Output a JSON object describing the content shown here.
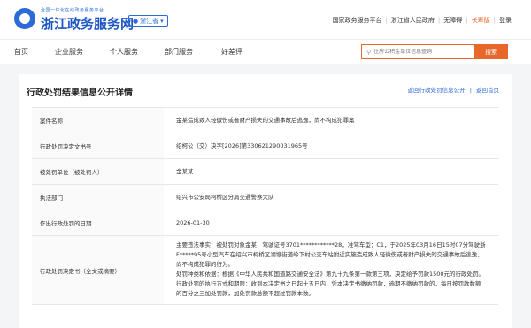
{
  "header": {
    "logo_subtitle": "全国一体化在线政务服务平台",
    "logo_title": "浙江政务服务网",
    "region": "浙江省",
    "links": [
      "国家政务服务平台",
      "浙江省人民政府",
      "无障碍",
      "长辈版",
      "登录"
    ]
  },
  "nav": {
    "items": [
      "首页",
      "企业服务",
      "个人服务",
      "部门服务",
      "好差评"
    ],
    "search_placeholder": "住房公积金单位信息查询",
    "search_button": "搜索"
  },
  "page": {
    "title": "行政处罚结果信息公开详情",
    "link_back": "返回行政处罚信息公开",
    "link_home": "返回首页"
  },
  "details": [
    {
      "label": "案件名称",
      "value": "金某造成致人轻微伤或者财产损失的交通事故后逃逸，尚不构成犯罪案"
    },
    {
      "label": "行政处罚决定文书号",
      "value": "绍柯公（交）决字[2026]第330621290031965号"
    },
    {
      "label": "被处罚单位（被处罚人）",
      "value": "金某某"
    },
    {
      "label": "执法部门",
      "value": "绍兴市公安局柯桥区分局交通警察大队"
    },
    {
      "label": "作出行政处罚的日期",
      "value": "2026-01-30"
    },
    {
      "label": "行政处罚决定书（全文或摘要）",
      "paragraphs": [
        "主要违法事实：被处罚对象金某，驾驶证号3701************28，准驾车型：C1，于2025年03月16日15时07分驾驶浙F*****95号小型汽车在绍兴市柯桥区湖塘街道岭下村公交车站附近实施造成致人轻微伤或者财产损失的交通事故后逃逸，尚不构成犯罪的行为。",
        "处罚种类和依据：根据《中华人民共和国道路交通安全法》第九十九条第一款第三项，决定给予罚款1500元的行政处罚。",
        "行政处罚的执行方式和期限：收到本决定书之日起十五日内，凭本决定书缴纳罚款，逾期不缴纳罚款的，每日按罚款数额的百分之三加处罚款，加处罚款总额不超过罚款本数。"
      ]
    }
  ]
}
